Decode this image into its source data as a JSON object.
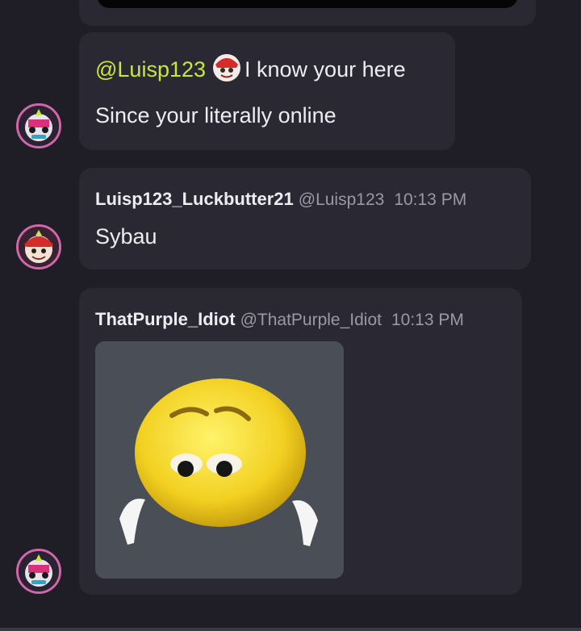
{
  "messages": [
    {
      "mention": "@Luisp123",
      "line1_text": "I know your here",
      "line2_text": "Since your literally online"
    },
    {
      "author": "Luisp123_Luckbutter21",
      "handle": "@Luisp123",
      "time": "10:13 PM",
      "text": "Sybau"
    },
    {
      "author": "ThatPurple_Idiot",
      "handle": "@ThatPurple_Idiot",
      "time": "10:13 PM",
      "attachment_icon": "sad-emoji-sticker"
    }
  ],
  "colors": {
    "background": "#1f1e27",
    "bubble": "#2a2933",
    "mention": "#c7e83b",
    "muted": "#9a99a4",
    "avatar_border": "#cf67a8"
  }
}
